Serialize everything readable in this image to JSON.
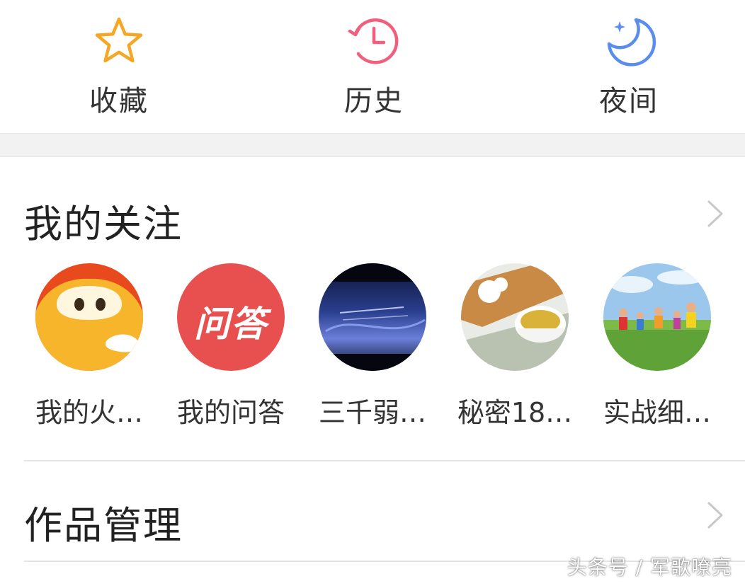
{
  "quick_actions": [
    {
      "label": "收藏",
      "icon": "star-icon",
      "color": "#f5a623"
    },
    {
      "label": "历史",
      "icon": "history-clock-icon",
      "color": "#f0607e"
    },
    {
      "label": "夜间",
      "icon": "moon-icon",
      "color": "#5b8def"
    }
  ],
  "follow_section": {
    "title": "我的关注",
    "items": [
      {
        "name": "我的火…",
        "avatar": "fire-mascot-avatar"
      },
      {
        "name": "我的问答",
        "avatar": "qa-logo-avatar",
        "logo_text": "问答"
      },
      {
        "name": "三千弱…",
        "avatar": "night-sky-avatar"
      },
      {
        "name": "秘密18…",
        "avatar": "tea-cup-avatar"
      },
      {
        "name": "实战细…",
        "avatar": "kids-meadow-avatar"
      }
    ]
  },
  "works_section": {
    "title": "作品管理"
  },
  "watermark": "头条号 / 军歌嘹亮",
  "colors": {
    "divider": "#e4e4e4",
    "band": "#f2f2f2",
    "chevron": "#c8c8c8"
  }
}
